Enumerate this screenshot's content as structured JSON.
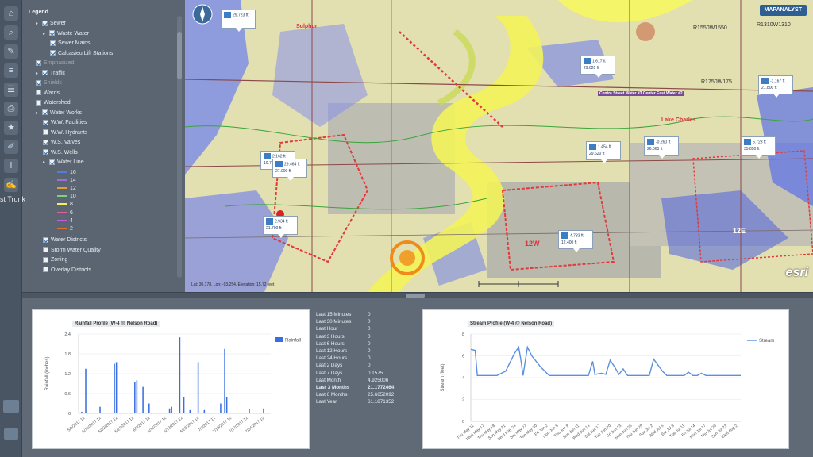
{
  "legend": {
    "title": "Legend",
    "partial_overlay_text": "st Trunk",
    "items": [
      {
        "label": "Sewer",
        "checked": true,
        "indent": 1,
        "arrow": true,
        "dim": false
      },
      {
        "label": "Waste Water",
        "checked": true,
        "indent": 2,
        "arrow": true,
        "dim": false
      },
      {
        "label": "Sewer Mains",
        "checked": true,
        "indent": 3,
        "arrow": false,
        "dim": false
      },
      {
        "label": "Calcasieu Lift Stations",
        "checked": true,
        "indent": 3,
        "arrow": false,
        "dim": false
      },
      {
        "label": "Emphasized",
        "checked": true,
        "indent": 1,
        "arrow": false,
        "dim": true
      },
      {
        "label": "Traffic",
        "checked": true,
        "indent": 1,
        "arrow": true,
        "dim": false
      },
      {
        "label": "Shields",
        "checked": true,
        "indent": 1,
        "arrow": false,
        "dim": true
      },
      {
        "label": "Wards",
        "checked": false,
        "indent": 1,
        "arrow": false,
        "dim": false
      },
      {
        "label": "Watershed",
        "checked": false,
        "indent": 1,
        "arrow": false,
        "dim": false
      },
      {
        "label": "Water Works",
        "checked": true,
        "indent": 1,
        "arrow": true,
        "dim": false
      },
      {
        "label": "W.W. Facilities",
        "checked": true,
        "indent": 2,
        "arrow": false,
        "dim": false
      },
      {
        "label": "W.W. Hydrants",
        "checked": false,
        "indent": 2,
        "arrow": false,
        "dim": false
      },
      {
        "label": "W.S. Valves",
        "checked": true,
        "indent": 2,
        "arrow": false,
        "dim": false
      },
      {
        "label": "W.S. Wells",
        "checked": true,
        "indent": 2,
        "arrow": false,
        "dim": false
      },
      {
        "label": "Water Line",
        "checked": true,
        "indent": 2,
        "arrow": true,
        "dim": false
      }
    ],
    "water_line_sizes": [
      {
        "label": "16",
        "color": "#4f7fe0"
      },
      {
        "label": "14",
        "color": "#9b6fd6"
      },
      {
        "label": "12",
        "color": "#e0a030"
      },
      {
        "label": "10",
        "color": "#7fd07f"
      },
      {
        "label": "8",
        "color": "#f0f060"
      },
      {
        "label": "6",
        "color": "#e060a0"
      },
      {
        "label": "4",
        "color": "#c060e0"
      },
      {
        "label": "2",
        "color": "#e07030"
      }
    ],
    "bottom_items": [
      {
        "label": "Water Districts",
        "checked": true
      },
      {
        "label": "Storm Water Quality",
        "checked": false
      },
      {
        "label": "Zoning",
        "checked": false
      },
      {
        "label": "Overlay Districts",
        "checked": false
      }
    ]
  },
  "map": {
    "logo": "MAPANALYST",
    "attribution": "esri",
    "coords": "Lat: 30.178, Lon: -93.254, Elevation: 15.72 feet",
    "labels": [
      {
        "text": "Sulphur",
        "color": "#d8323c"
      },
      {
        "text": "Lake Charles",
        "color": "#d8323c"
      },
      {
        "text": "12W",
        "color": "#d8323c"
      },
      {
        "text": "12E",
        "color": "#ffffff"
      },
      {
        "text": "R1750W175",
        "color": "#333333"
      },
      {
        "text": "R1550W1550",
        "color": "#333333"
      },
      {
        "text": "R1310W1310",
        "color": "#333333"
      },
      {
        "text": "Centre Street Water #3 Center East Water #2",
        "color": "#ffffff"
      }
    ],
    "gauges": [
      {
        "value": "1.617 ft",
        "sub": "29.620 ft"
      },
      {
        "value": "1.454 ft",
        "sub": "29.620 ft"
      },
      {
        "value": "-0.260 ft",
        "sub": "26.065 ft"
      },
      {
        "value": "5.723 ft",
        "sub": "35.850 ft"
      },
      {
        "value": "-1.167 ft",
        "sub": "21.800 ft"
      },
      {
        "value": "2.162 ft",
        "sub": "10.700 ft"
      },
      {
        "value": "29.464 ft",
        "sub": "27.000 ft"
      },
      {
        "value": "2.934 ft",
        "sub": "21.700 ft"
      },
      {
        "value": "4.733 ft",
        "sub": "12.400 ft"
      },
      {
        "value": "29.723 ft",
        "sub": ""
      }
    ]
  },
  "rainfall": {
    "title": "Rainfall Profile (W-4 @ Nelson Road)",
    "legend": "Rainfall",
    "ylabel": "Rainfall (inches)"
  },
  "stream": {
    "title": "Stream Profile (W-4 @ Nelson Road)",
    "legend": "Stream",
    "ylabel": "Stream (feet)"
  },
  "stats": [
    {
      "label": "Last 15 Minutes",
      "value": "0",
      "bold": false
    },
    {
      "label": "Last 30 Minutes",
      "value": "0",
      "bold": false
    },
    {
      "label": "Last Hour",
      "value": "0",
      "bold": false
    },
    {
      "label": "Last 3 Hours",
      "value": "0",
      "bold": false
    },
    {
      "label": "Last 6 Hours",
      "value": "0",
      "bold": false
    },
    {
      "label": "Last 12 Hours",
      "value": "0",
      "bold": false
    },
    {
      "label": "Last 24 Hours",
      "value": "0",
      "bold": false
    },
    {
      "label": "Last 2 Days",
      "value": "0",
      "bold": false
    },
    {
      "label": "Last 7 Days",
      "value": "0.1575",
      "bold": false
    },
    {
      "label": "Last Month",
      "value": "4.925006",
      "bold": false
    },
    {
      "label": "Last 3 Months",
      "value": "21.1772464",
      "bold": true
    },
    {
      "label": "Last 6 Months",
      "value": "25.6652092",
      "bold": false
    },
    {
      "label": "Last Year",
      "value": "61.1871352",
      "bold": false
    }
  ],
  "chart_data": [
    {
      "type": "bar",
      "title": "Rainfall Profile (W-4 @ Nelson Road)",
      "ylabel": "Rainfall (inches)",
      "ylim": [
        0,
        2.4
      ],
      "yticks": [
        0,
        0.6,
        1.2,
        1.8,
        2.4
      ],
      "xticks": [
        "5/5/2017 12",
        "5/15/2017 12",
        "5/22/2017 12",
        "5/29/2017 12",
        "6/5/2017 12",
        "6/12/2017 12",
        "6/19/2017 12",
        "6/26/2017 12",
        "7/3/2017 12",
        "7/10/2017 12",
        "7/17/2017 12",
        "7/24/2017 12"
      ],
      "series": [
        {
          "name": "Rainfall",
          "color": "#3b6fe0",
          "values": [
            0.0,
            0.05,
            0.0,
            1.35,
            0.0,
            0.0,
            0.0,
            0.0,
            0.0,
            0.0,
            0.2,
            0.0,
            0.0,
            0.0,
            0.0,
            0.0,
            0.0,
            1.5,
            1.55,
            0.0,
            0.0,
            0.0,
            0.0,
            0.0,
            0.0,
            0.0,
            0.0,
            0.95,
            1.0,
            0.0,
            0.0,
            0.8,
            0.0,
            0.0,
            0.3,
            0.0,
            0.0,
            0.0,
            0.0,
            0.0,
            0.0,
            0.0,
            0.0,
            0.0,
            0.15,
            0.2,
            0.0,
            0.0,
            0.0,
            2.3,
            0.0,
            0.5,
            0.0,
            0.0,
            0.1,
            0.0,
            0.0,
            0.0,
            1.55,
            0.0,
            0.0,
            0.1,
            0.0,
            0.0,
            0.0,
            0.0,
            0.0,
            0.0,
            0.0,
            0.3,
            0.0,
            1.95,
            0.5,
            0.0,
            0.0,
            0.0,
            0.0,
            0.0,
            0.0,
            0.0,
            0.0,
            0.0,
            0.0,
            0.12,
            0.0,
            0.0,
            0.0,
            0.0,
            0.0,
            0.0,
            0.15,
            0.0,
            0.0,
            0.0
          ]
        }
      ]
    },
    {
      "type": "line",
      "title": "Stream Profile (W-4 @ Nelson Road)",
      "ylabel": "Stream (feet)",
      "ylim": [
        0,
        8
      ],
      "yticks": [
        0,
        2,
        4,
        6,
        8
      ],
      "xticks": [
        "Thu May 11",
        "Wed May 17",
        "Thu May 18",
        "Sun May 21",
        "Wed May 24",
        "Sat May 27",
        "Tue May 30",
        "Fri Jun 2",
        "Mon Jun 5",
        "Thu Jun 8",
        "Sun Jun 11",
        "Wed Jun 14",
        "Sat Jun 17",
        "Tue Jun 20",
        "Fri Jun 23",
        "Mon Jun 26",
        "Thu Jun 29",
        "Sun Jul 2",
        "Wed Jul 5",
        "Sat Jul 8",
        "Tue Jul 11",
        "Fri Jul 14",
        "Mon Jul 17",
        "Thu Jul 20",
        "Sun Jul 23",
        "Wed Aug 2"
      ],
      "series": [
        {
          "name": "Stream",
          "color": "#5b8fe0",
          "points": [
            [
              0,
              6.6
            ],
            [
              1,
              6.5
            ],
            [
              1.5,
              4.2
            ],
            [
              4,
              4.2
            ],
            [
              6,
              4.2
            ],
            [
              8,
              4.6
            ],
            [
              10,
              6.2
            ],
            [
              11,
              6.8
            ],
            [
              11.5,
              5.6
            ],
            [
              12,
              4.2
            ],
            [
              13,
              6.8
            ],
            [
              14,
              6.0
            ],
            [
              16,
              5.0
            ],
            [
              18,
              4.2
            ],
            [
              22,
              4.2
            ],
            [
              24,
              4.2
            ],
            [
              27,
              4.2
            ],
            [
              28,
              5.5
            ],
            [
              28.5,
              4.3
            ],
            [
              30,
              4.4
            ],
            [
              31,
              4.3
            ],
            [
              32,
              5.6
            ],
            [
              33,
              5.0
            ],
            [
              34,
              4.3
            ],
            [
              35,
              4.8
            ],
            [
              36,
              4.2
            ],
            [
              40,
              4.2
            ],
            [
              41,
              4.2
            ],
            [
              42,
              5.7
            ],
            [
              44,
              4.6
            ],
            [
              45,
              4.2
            ],
            [
              49,
              4.2
            ],
            [
              50,
              4.5
            ],
            [
              51,
              4.2
            ],
            [
              52,
              4.2
            ],
            [
              53,
              4.4
            ],
            [
              54,
              4.2
            ],
            [
              60,
              4.2
            ],
            [
              62,
              4.2
            ]
          ]
        }
      ]
    }
  ]
}
